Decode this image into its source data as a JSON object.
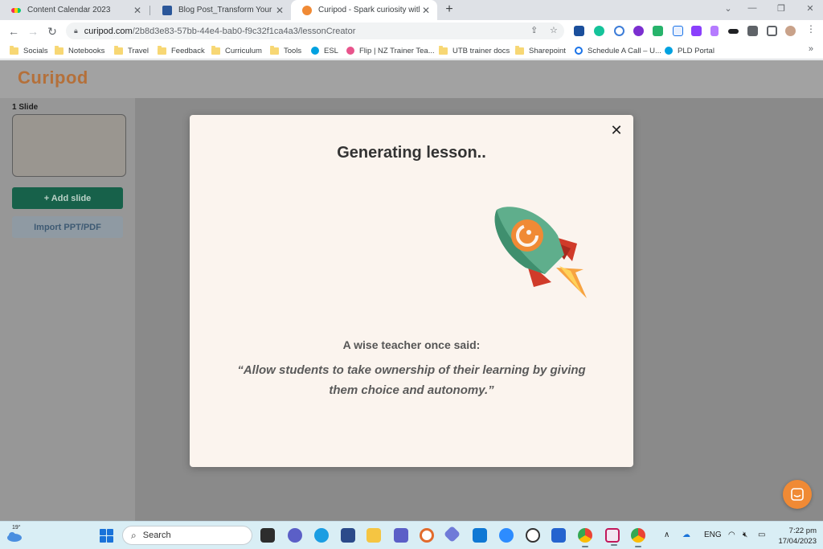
{
  "browser": {
    "tabs": [
      {
        "title": "Content Calendar 2023",
        "icon": "monday-icon",
        "active": false
      },
      {
        "title": "Blog Post_Transform Your Teachin",
        "icon": "word-icon",
        "active": false
      },
      {
        "title": "Curipod - Spark curiosity with int",
        "icon": "curipod-icon",
        "active": true
      }
    ],
    "new_tab_label": "+",
    "address": {
      "host": "curipod.com",
      "path": "/2b8d3e83-57bb-44e4-bab0-f9c32f1ca4a3/lessonCreator"
    },
    "bookmarks": [
      {
        "label": "Socials",
        "icon": "folder-icon"
      },
      {
        "label": "Notebooks",
        "icon": "folder-icon"
      },
      {
        "label": "Travel",
        "icon": "folder-icon"
      },
      {
        "label": "Feedback",
        "icon": "folder-icon"
      },
      {
        "label": "Curriculum",
        "icon": "folder-icon"
      },
      {
        "label": "Tools",
        "icon": "folder-icon"
      },
      {
        "label": "ESL",
        "icon": "salesforce-icon"
      },
      {
        "label": "Flip | NZ Trainer Tea...",
        "icon": "flip-icon"
      },
      {
        "label": "UTB trainer docs",
        "icon": "folder-icon"
      },
      {
        "label": "Sharepoint",
        "icon": "folder-icon"
      },
      {
        "label": "Schedule A Call – U...",
        "icon": "calendar-icon"
      },
      {
        "label": "PLD Portal",
        "icon": "salesforce-icon"
      }
    ],
    "bookmarks_more": "»"
  },
  "app": {
    "logo": "Curipod",
    "sidebar": {
      "slide_count": "1 Slide",
      "add_slide_label": "+ Add slide",
      "import_label": "Import PPT/PDF"
    },
    "modal": {
      "title": "Generating lesson..",
      "close_label": "✕",
      "quote_intro": "A wise teacher once said:",
      "quote": "“Allow students to take ownership of their learning by giving them choice and autonomy.”"
    }
  },
  "taskbar": {
    "weather_temp": "19°",
    "search_label": "Search",
    "language": "ENG",
    "time": "7:22 pm",
    "date": "17/04/2023"
  },
  "colors": {
    "curipod_orange": "#f08a35",
    "add_slide_green": "#17614a",
    "modal_bg": "#fbf4ee"
  }
}
